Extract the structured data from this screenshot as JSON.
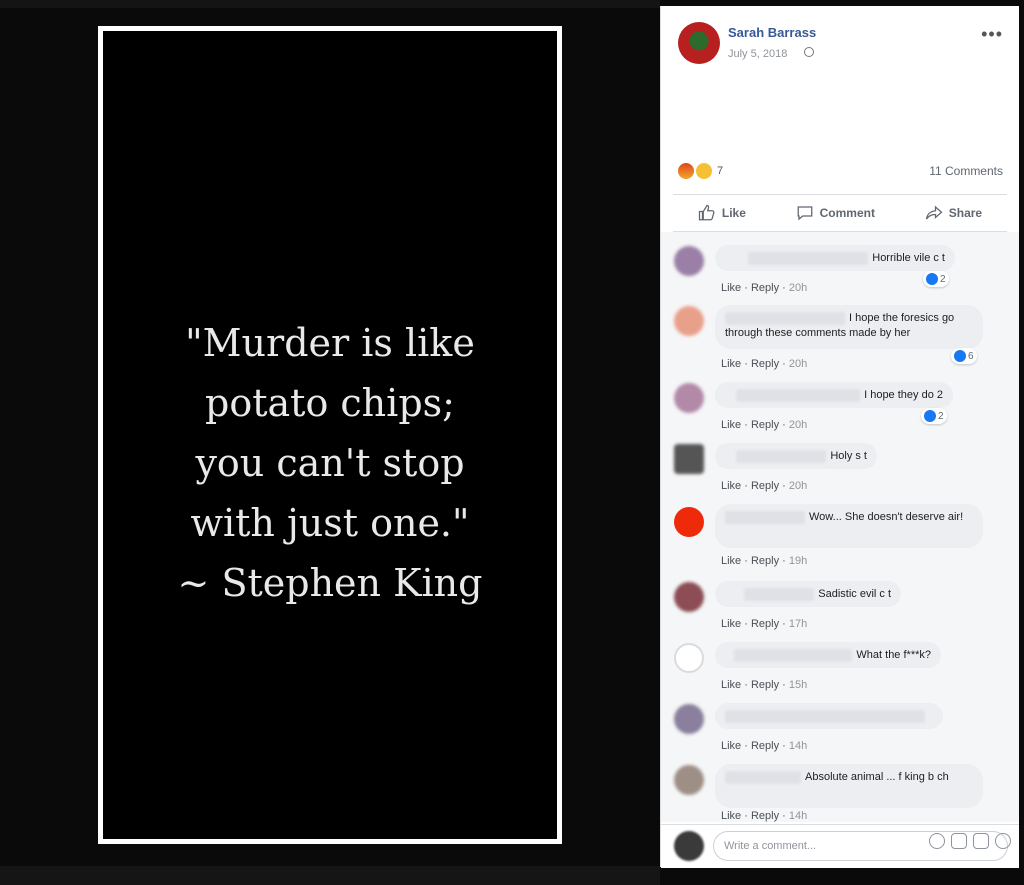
{
  "photo": {
    "quote": "\"Murder is like\npotato chips;\nyou can't stop\nwith just one.\"\n~ Stephen King"
  },
  "post": {
    "author": "Sarah Barrass",
    "date": "July 5, 2018",
    "reaction_count": "7",
    "comments_count": "11 Comments"
  },
  "actions": {
    "like": "Like",
    "comment": "Comment",
    "share": "Share"
  },
  "comments": [
    {
      "text": "Horrible vile c  t",
      "likes": "2",
      "time": "20h",
      "avatar": "#9b7fa6"
    },
    {
      "text": "I hope the foresics go through these comments made by her",
      "likes": "6",
      "time": "20h",
      "avatar": "#e9a08a"
    },
    {
      "text": "I hope they do 2",
      "likes": "2",
      "time": "20h",
      "avatar": "#b28aa8"
    },
    {
      "text": "Holy s  t",
      "likes": "",
      "time": "20h",
      "avatar": "#555555"
    },
    {
      "text": "Wow... She doesn't deserve air!",
      "likes": "",
      "time": "19h",
      "avatar": "#ee2a0a"
    },
    {
      "text": "Sadistic evil c  t",
      "likes": "",
      "time": "17h",
      "avatar": "#8c4d55"
    },
    {
      "text": "What the f***k?",
      "likes": "",
      "time": "15h",
      "avatar": "#d9dbde"
    },
    {
      "text": "",
      "likes": "",
      "time": "14h",
      "avatar": "#8a7f9d"
    },
    {
      "text": "Absolute animal ... f   king b  ch",
      "likes": "",
      "time": "14h",
      "avatar": "#9e8f86"
    }
  ],
  "comment_meta": {
    "like": "Like",
    "reply": "Reply"
  },
  "write": {
    "placeholder": "Write a comment..."
  },
  "colors": {
    "link": "#385898",
    "like_blue": "#1877f2"
  }
}
